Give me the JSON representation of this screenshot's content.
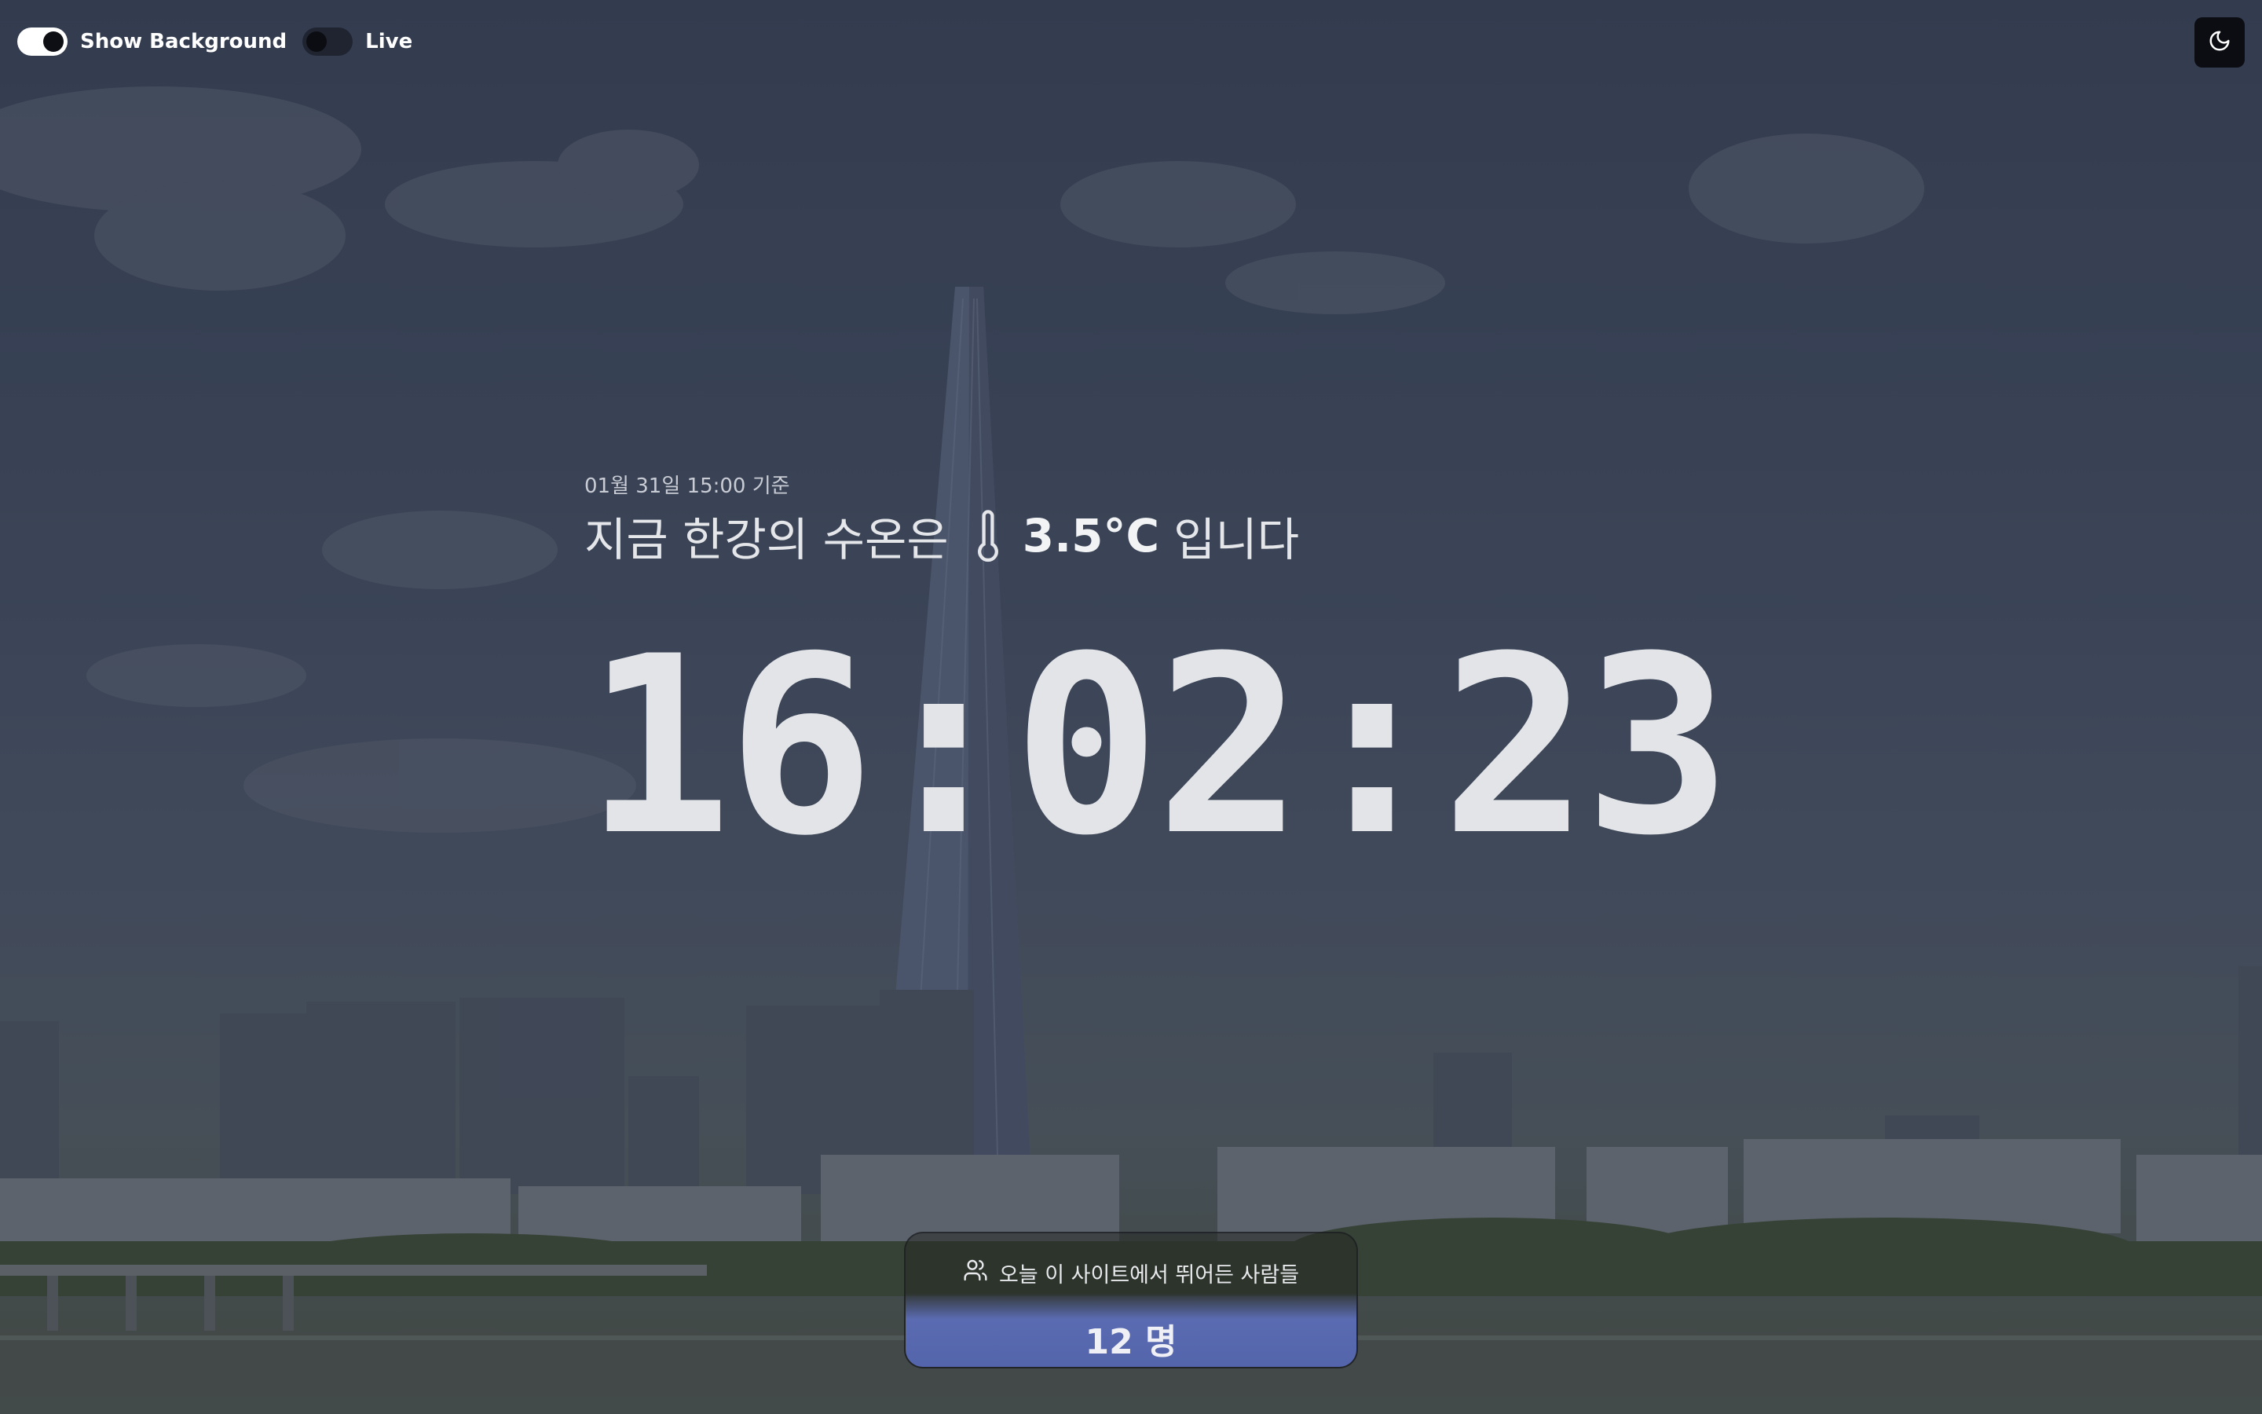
{
  "controls": {
    "show_background_label": "Show Background",
    "show_background_on": true,
    "live_label": "Live",
    "live_on": false,
    "theme_icon": "moon-icon"
  },
  "water": {
    "as_of": "01월 31일 15:00 기준",
    "lead": "지금 한강의 수온은",
    "temperature": "3.5°C",
    "tail": "입니다",
    "icon": "thermometer-icon"
  },
  "clock": {
    "time": "16:02:23"
  },
  "visitors": {
    "icon": "users-icon",
    "label": "오늘 이 사이트에서 뛰어든 사람들",
    "count": "12 명"
  },
  "colors": {
    "text": "#e4e6ea",
    "card_accent": "#5a6bb2",
    "button_bg": "#0b0d12"
  }
}
